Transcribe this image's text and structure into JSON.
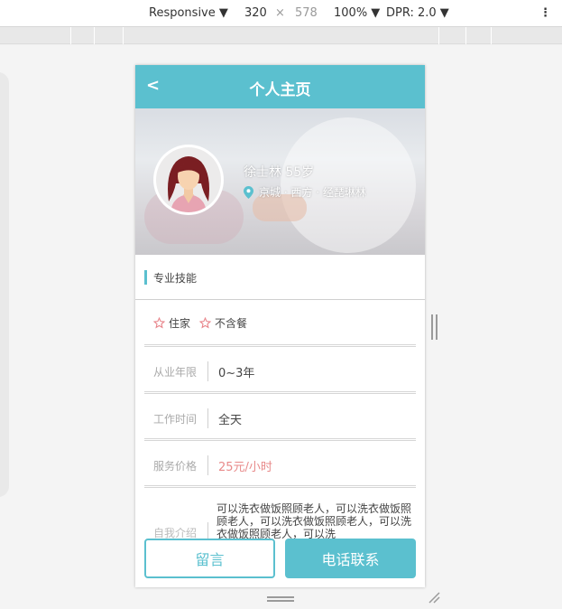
{
  "devtools": {
    "device_mode": "Responsive ▼",
    "width": "320",
    "times": "×",
    "height": "578",
    "zoom": "100% ▼",
    "dpr": "DPR: 2.0 ▼",
    "menu": "⋮"
  },
  "header": {
    "back_label": "<",
    "title": "个人主页"
  },
  "profile": {
    "name": "徐士林 55岁",
    "location": "京城 · 西方 · 经琵琳林"
  },
  "skills": {
    "section_title": "专业技能",
    "tags": [
      "住家",
      "不含餐"
    ]
  },
  "details": {
    "experience_label": "从业年限",
    "experience_value": "0~3年",
    "hours_label": "工作时间",
    "hours_value": "全天",
    "price_label": "服务价格",
    "price_value": "25元/小时",
    "intro_label": "自我介绍",
    "intro_value": "可以洗衣做饭照顾老人，可以洗衣做饭照顾老人，可以洗衣做饭照顾老人，可以洗衣做饭照顾老人，可以洗"
  },
  "actions": {
    "message_label": "留言",
    "call_label": "电话联系"
  },
  "colors": {
    "accent": "#5bc0cf",
    "price": "#e88a8a",
    "star": "#e8848a"
  }
}
